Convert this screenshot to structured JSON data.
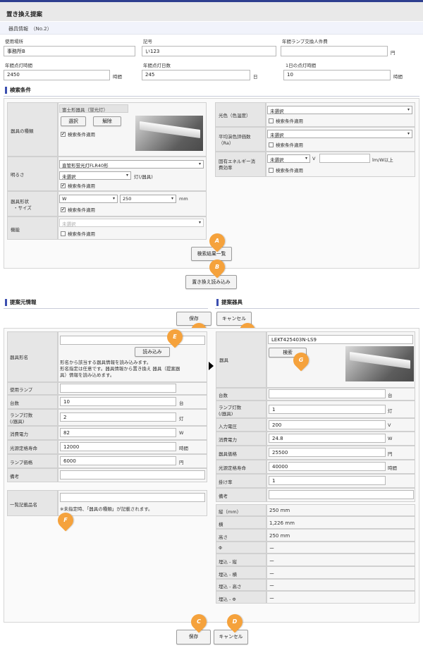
{
  "title": "置き換え提案",
  "subtitle": "器具情報　（No.2）",
  "top": {
    "location_label": "使用場所",
    "location_value": "事務所B",
    "code_label": "記号",
    "code_value": "い123",
    "lamp_cost_label": "年間ランプ交換人件費",
    "lamp_cost_unit": "円",
    "annual_hours_label": "年間点灯時間",
    "annual_hours_value": "2450",
    "annual_hours_unit": "時間",
    "annual_days_label": "年間点灯日数",
    "annual_days_value": "245",
    "annual_days_unit": "日",
    "daily_hours_label": "1日の点灯時間",
    "daily_hours_value": "10",
    "daily_hours_unit": "時間"
  },
  "search": {
    "heading": "検索条件",
    "fixture_type_label": "器具の種類",
    "fixture_type_value": "富士形器具（蛍光灯）",
    "select_btn": "選択",
    "clear_btn": "解除",
    "apply": "検索条件適用",
    "brightness_label": "明るさ",
    "brightness_select": "直管形蛍光灯FLR40形",
    "brightness_sub_select": "未選択",
    "brightness_unit": "灯(/器具)",
    "shape_label_1": "器具形状",
    "shape_label_2": "・サイズ",
    "shape_select": "W",
    "shape_value": "250",
    "shape_unit": "mm",
    "function_label": "機能",
    "function_select": "未選択",
    "color_label": "光色（色温度）",
    "color_select": "未選択",
    "cri_label_1": "平均演色評価数",
    "cri_label_2": "（Ra）",
    "cri_select": "未選択",
    "eff_label_1": "固有エネルギー消",
    "eff_label_2": "費効率",
    "eff_select": "未選択",
    "eff_unit_v": "V",
    "eff_unit": "lm/W以上",
    "results_btn": "検索結果一覧",
    "load_btn": "置き換え読み込み"
  },
  "markers": {
    "a": "A",
    "b": "B",
    "c": "C",
    "d": "D",
    "e": "E",
    "f": "F",
    "g": "G"
  },
  "source": {
    "heading": "提案元情報",
    "model_label": "器具形名",
    "load_btn": "読み込み",
    "note_1": "形名から該当する器具情報を読み込みます。",
    "note_2": "形名指定は任意です。器具情報から置き換え 器具（提案器",
    "note_3": "具）情報を読み込めます。",
    "rows": [
      {
        "label": "使用ランプ",
        "value": "",
        "unit": ""
      },
      {
        "label": "台数",
        "value": "10",
        "unit": "台"
      },
      {
        "label": "ランプ灯数",
        "label2": "(/器具)",
        "value": "2",
        "unit": "灯"
      },
      {
        "label": "消費電力",
        "value": "82",
        "unit": "W"
      },
      {
        "label": "光源定格寿命",
        "value": "12000",
        "unit": "時間"
      },
      {
        "label": "ランプ価格",
        "value": "6000",
        "unit": "円"
      },
      {
        "label": "備考",
        "value": "",
        "unit": ""
      }
    ],
    "list_label": "一覧記載品名",
    "list_note": "※未指定時、「器具の種類」が記載されます。"
  },
  "proposal": {
    "heading": "提案器具",
    "fixture_label": "器具",
    "model_value": "LEKT425403N-LS9",
    "search_btn": "検索",
    "rows": [
      {
        "label": "台数",
        "value": "",
        "unit": "台"
      },
      {
        "label": "ランプ灯数",
        "label2": "(/器具)",
        "value": "1",
        "unit": "灯"
      },
      {
        "label": "入力電圧",
        "value": "200",
        "unit": "V"
      },
      {
        "label": "消費電力",
        "value": "24.8",
        "unit": "W"
      },
      {
        "label": "器具価格",
        "value": "25500",
        "unit": "円"
      },
      {
        "label": "光源定格寿命",
        "value": "40000",
        "unit": "時間"
      },
      {
        "label": "掛け率",
        "value": "1",
        "unit": ""
      },
      {
        "label": "備考",
        "value": "",
        "unit": ""
      }
    ],
    "specs": [
      {
        "label": "縦（mm）",
        "value": "250 mm"
      },
      {
        "label": "横",
        "value": "1,226 mm"
      },
      {
        "label": "高さ",
        "value": "250 mm"
      },
      {
        "label": "Φ",
        "value": "ー"
      },
      {
        "label": "埋込 - 縦",
        "value": "ー"
      },
      {
        "label": "埋込 - 横",
        "value": "ー"
      },
      {
        "label": "埋込 - 高さ",
        "value": "ー"
      },
      {
        "label": "埋込 - Φ",
        "value": "ー"
      }
    ]
  },
  "save_btn": "保存",
  "cancel_btn": "キャンセル"
}
